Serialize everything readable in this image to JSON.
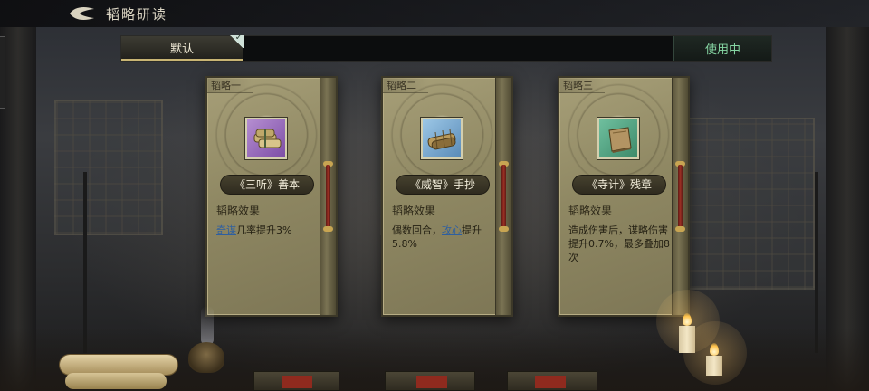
{
  "header": {
    "title": "韬略研读"
  },
  "presets": {
    "active_tab": "默认",
    "status_button": "使用中"
  },
  "cards": [
    {
      "tag": "韬略一",
      "name": "《三听》善本",
      "effect_label": "韬略效果",
      "desc_keyword": "奇谋",
      "desc_rest": "几率提升3%",
      "icon": "scroll-bundle-icon",
      "rarity_color": "#9d6fc4"
    },
    {
      "tag": "韬略二",
      "name": "《威智》手抄",
      "effect_label": "韬略效果",
      "desc_before": "偶数回合，",
      "desc_keyword": "攻心",
      "desc_rest": "提升5.8%",
      "icon": "bamboo-scroll-icon",
      "rarity_color": "#6fa6d4"
    },
    {
      "tag": "韬略三",
      "name": "《寺计》残章",
      "effect_label": "韬略效果",
      "desc": "造成伤害后，谋略伤害提升0.7%，最多叠加8次",
      "icon": "book-icon",
      "rarity_color": "#4fa883"
    }
  ]
}
